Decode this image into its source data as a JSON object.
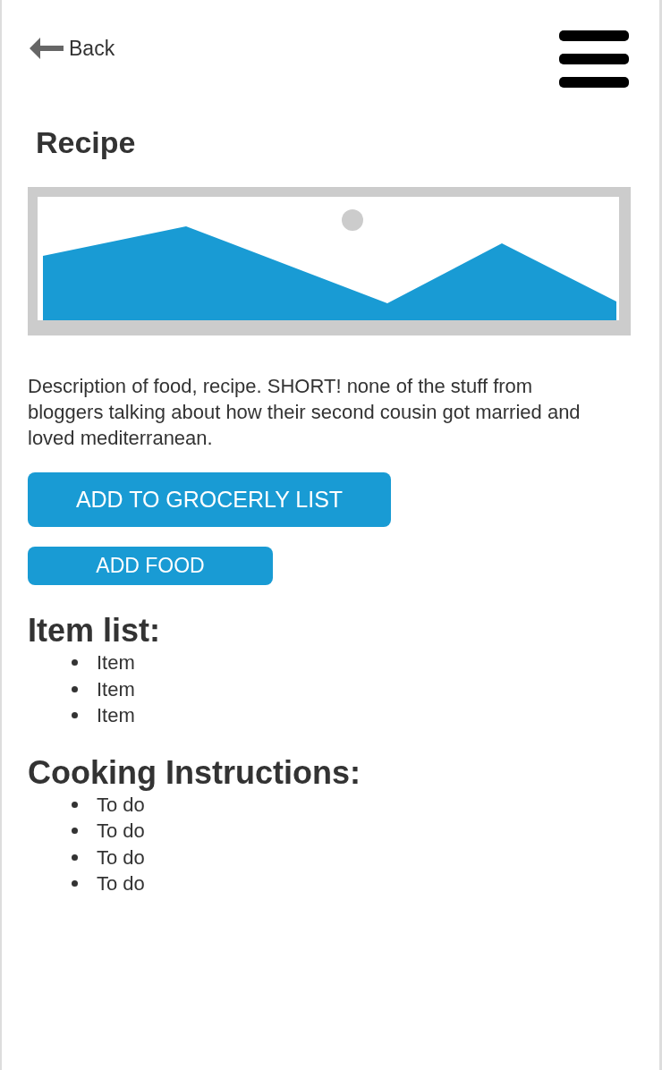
{
  "header": {
    "back_label": "Back"
  },
  "title": "Recipe",
  "description": "Description of food, recipe. SHORT! none of the stuff from bloggers talking about how their second cousin got married and loved mediterranean.",
  "buttons": [
    {
      "label": "ADD TO GROCERLY LIST",
      "kind": "wide"
    },
    {
      "label": "ADD FOOD",
      "kind": "narrow"
    }
  ],
  "sections": [
    {
      "heading": "Item list:",
      "items": [
        "Item",
        "Item",
        "Item"
      ]
    },
    {
      "heading": "Cooking Instructions:",
      "items": [
        "To do",
        "To do",
        "To do",
        "To do"
      ]
    }
  ]
}
